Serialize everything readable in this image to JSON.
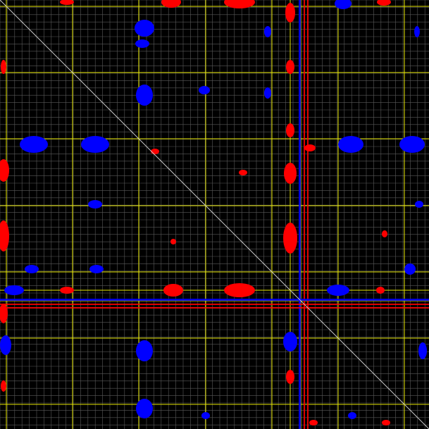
{
  "colors": {
    "background": "#000000",
    "fine_grid": "#5a5a5a",
    "major_grid": "#e6e600",
    "diagonal": "#c8c8c8",
    "positive_peak": "#ff0000",
    "negative_peak": "#0000ff"
  },
  "view": {
    "type": "2d-nmr-contour-plot",
    "symmetric_about_diagonal": true,
    "grid_visible": true,
    "axis_labels_visible": false
  }
}
